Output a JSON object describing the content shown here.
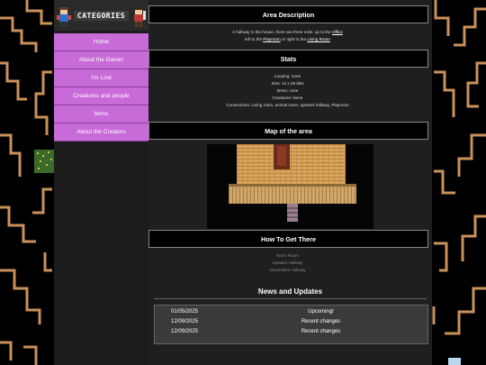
{
  "sidebar": {
    "header_title": "CATEGORIES",
    "nav": [
      "Home",
      "About the Game!",
      "I'm Lost",
      "Creatures and people",
      "Items",
      "About the Creators"
    ]
  },
  "area_description": {
    "heading": "Area Description",
    "line1": {
      "text1": "A hallway in the house, there are three exits. up to the ",
      "link1": "Office"
    },
    "line2": {
      "text1": "left to the ",
      "link1": "Playroom",
      "text2": " or right to the ",
      "link2": "Living Room"
    }
  },
  "stats": {
    "heading": "Stats",
    "lines": [
      "Looping: none",
      "Size: 14 x 29 tiles",
      "Items: none",
      "Creatures: None",
      "Connections: Living room, animal room, upstairs hallway, Playroom"
    ]
  },
  "map_section": {
    "heading": "Map of the area"
  },
  "how_to": {
    "heading": "How To Get There",
    "steps": [
      "Nao's Room",
      "Upstairs Hallway",
      "Downstairs Hallway"
    ]
  },
  "news": {
    "heading": "News and Updates",
    "rows": [
      {
        "date": "01/05/2025",
        "title": "Upcoming!"
      },
      {
        "date": "12/09/2025",
        "title": "Recent changes"
      },
      {
        "date": "12/09/2025",
        "title": "Recent changes"
      }
    ]
  },
  "colors": {
    "nav_bg": "#c86ad8",
    "backdrop_line": "#c9915a",
    "page_bg": "#1f1f1f"
  }
}
